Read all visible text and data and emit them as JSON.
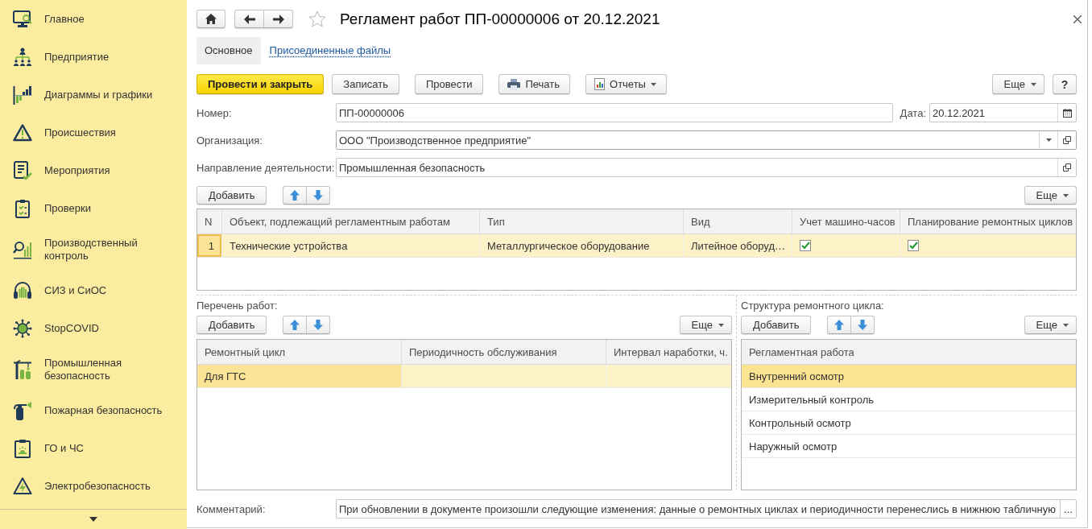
{
  "sidebar": {
    "items": [
      {
        "label": "Главное",
        "selected": false
      },
      {
        "label": "Предприятие",
        "selected": false
      },
      {
        "label": "Диаграммы и графики",
        "selected": false
      },
      {
        "label": "Происшествия",
        "selected": false
      },
      {
        "label": "Мероприятия",
        "selected": false
      },
      {
        "label": "Проверки",
        "selected": false
      },
      {
        "label": "Производственный контроль",
        "selected": false
      },
      {
        "label": "СИЗ и СиОС",
        "selected": false
      },
      {
        "label": "StopCOVID",
        "selected": false
      },
      {
        "label": "Промышленная безопасность",
        "selected": false
      },
      {
        "label": "Пожарная безопасность",
        "selected": false
      },
      {
        "label": "ГО и ЧС",
        "selected": false
      },
      {
        "label": "Электробезопасность",
        "selected": false
      }
    ]
  },
  "window": {
    "title": "Регламент работ ПП-00000006 от 20.12.2021",
    "favorite": false
  },
  "tabs": [
    {
      "label": "Основное",
      "selected": true
    },
    {
      "label": "Присоединенные файлы",
      "selected": false
    }
  ],
  "toolbar": {
    "buttons": [
      {
        "label": "Провести и закрыть",
        "kind": "primary"
      },
      {
        "label": "Записать",
        "kind": "plain"
      },
      {
        "label": "Провести",
        "kind": "plain"
      },
      {
        "label": "Печать",
        "kind": "print"
      },
      {
        "label": "Отчеты",
        "kind": "reports"
      }
    ],
    "more": "Еще",
    "help": "?"
  },
  "fields": {
    "number": {
      "label": "Номер:",
      "value": "ПП-00000006"
    },
    "date": {
      "label": "Дата:",
      "value": "20.12.2021"
    },
    "organization": {
      "label": "Организация:",
      "value": "ООО \"Производственное предприятие\""
    },
    "activity": {
      "label": "Направление деятельности:",
      "value": "Промышленная безопасность"
    }
  },
  "objects_table": {
    "add": "Добавить",
    "more": "Еще",
    "active": true,
    "columns": [
      "N",
      "Объект, подлежащий регламентным работам",
      "Тип",
      "Вид",
      "Учет машино-часов",
      "Планирование ремонтных циклов"
    ],
    "rows": [
      {
        "selected": true,
        "cells": [
          {
            "kind": "text",
            "text": "1",
            "focused": true
          },
          {
            "kind": "text",
            "text": "Технические устройства",
            "focused": false
          },
          {
            "kind": "text",
            "text": "Металлургическое оборудование",
            "focused": false
          },
          {
            "kind": "text",
            "text": "Литейное оборуд…",
            "focused": false
          },
          {
            "kind": "checkbox",
            "checked": true,
            "focused": false
          },
          {
            "kind": "checkbox",
            "checked": true,
            "focused": false
          }
        ]
      }
    ]
  },
  "works": {
    "label": "Перечень работ:",
    "add": "Добавить",
    "more": "Еще",
    "active": false,
    "columns": [
      "Ремонтный цикл",
      "Периодичность обслуживания",
      "Интервал наработки, ч."
    ],
    "rows": [
      {
        "selected": true,
        "cells": [
          {
            "kind": "text",
            "text": "Для ГТС",
            "focused": true
          },
          {
            "kind": "empty",
            "focused": false
          },
          {
            "kind": "empty",
            "focused": false
          }
        ]
      }
    ]
  },
  "cycle_structure": {
    "label": "Структура ремонтного цикла:",
    "add": "Добавить",
    "more": "Еще",
    "columns": [
      "Регламентная работа"
    ],
    "rows": [
      {
        "selected": true,
        "cells": [
          {
            "kind": "text",
            "text": "Внутренний осмотр"
          }
        ]
      },
      {
        "selected": false,
        "cells": [
          {
            "kind": "text",
            "text": "Измерительный контроль"
          }
        ]
      },
      {
        "selected": false,
        "cells": [
          {
            "kind": "text",
            "text": "Контрольный осмотр"
          }
        ]
      },
      {
        "selected": false,
        "cells": [
          {
            "kind": "text",
            "text": "Наружный осмотр"
          }
        ]
      }
    ]
  },
  "comment": {
    "label": "Комментарий:",
    "value": "При обновлении в документе произошли следующие изменения: данные о ремонтных циклах и периодичности перенеслись в нижнюю табличную",
    "button": "..."
  }
}
